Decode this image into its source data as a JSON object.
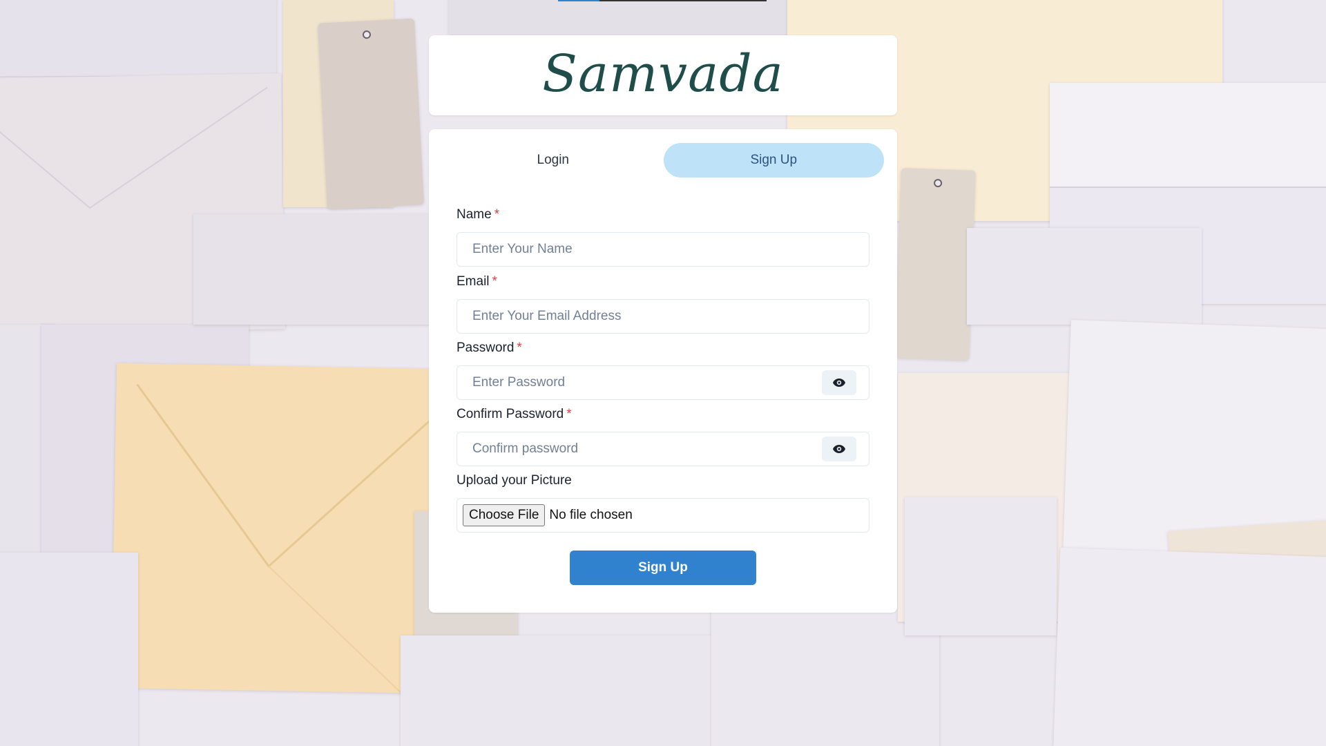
{
  "app": {
    "logo_text": "Samvada"
  },
  "loading_bar": {
    "progress": 0.2,
    "color": "#3182ce"
  },
  "tabs": [
    {
      "label": "Login",
      "active": false
    },
    {
      "label": "Sign Up",
      "active": true
    }
  ],
  "form": {
    "name": {
      "label": "Name",
      "required_mark": "*",
      "placeholder": "Enter Your Name",
      "value": ""
    },
    "email": {
      "label": "Email",
      "required_mark": "*",
      "placeholder": "Enter Your Email Address",
      "value": ""
    },
    "password": {
      "label": "Password",
      "required_mark": "*",
      "placeholder": "Enter Password",
      "value": "",
      "toggle_icon": "eye-icon"
    },
    "confirm_password": {
      "label": "Confirm Password",
      "required_mark": "*",
      "placeholder": "Confirm password",
      "value": "",
      "toggle_icon": "eye-icon"
    },
    "picture": {
      "label": "Upload your Picture",
      "button_label": "Choose File",
      "status": "No file chosen"
    },
    "submit_label": "Sign Up"
  },
  "colors": {
    "accent": "#3182ce",
    "active_tab_bg": "#bee3f8",
    "required": "#e53e3e",
    "logo": "#1f4d4a"
  }
}
